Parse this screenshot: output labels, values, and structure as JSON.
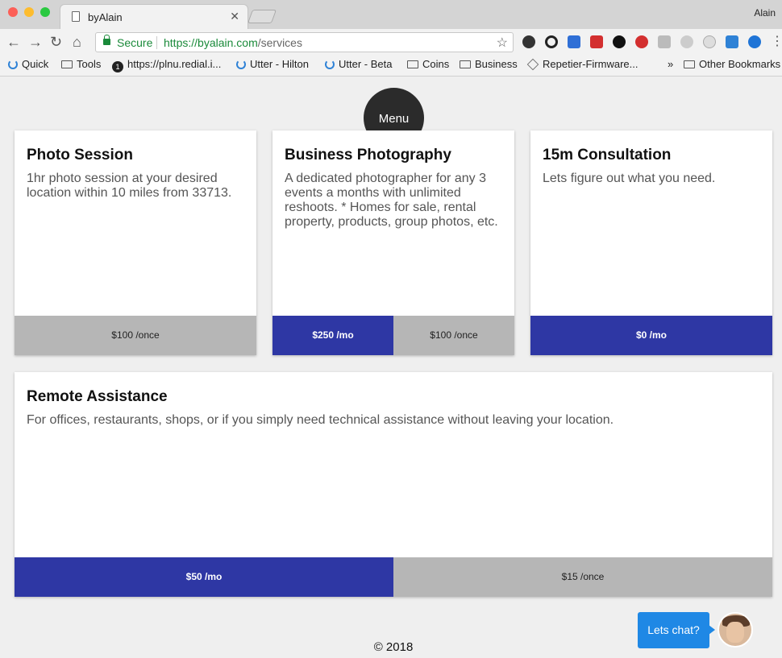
{
  "browser": {
    "tab_title": "byAlain",
    "profile": "Alain",
    "secure_label": "Secure",
    "url_scheme": "https://",
    "url_host": "byalain.com",
    "url_path": "/services",
    "bookmarks": [
      "Quick",
      "Tools",
      "https://plnu.redial.i...",
      "Utter - Hilton",
      "Utter - Beta",
      "Coins",
      "Business",
      "Repetier-Firmware...",
      "»",
      "Other Bookmarks"
    ]
  },
  "menu": {
    "label": "Menu"
  },
  "services": [
    {
      "title": "Photo Session",
      "description": "1hr photo session at your desired location within 10 miles from 33713.",
      "prices": [
        "$100 /once"
      ]
    },
    {
      "title": "Business Photography",
      "description": "A dedicated photographer for any 3 events a months with unlimited reshoots. * Homes for sale, rental property, products, group photos, etc.",
      "prices": [
        "$250 /mo",
        "$100 /once"
      ]
    },
    {
      "title": "15m Consultation",
      "description": "Lets figure out what you need.",
      "prices": [
        "$0 /mo"
      ]
    },
    {
      "title": "Remote Assistance",
      "description": "For offices, restaurants, shops, or if you simply need technical assistance without leaving your location.",
      "prices": [
        "$50 /mo",
        "$15 /once"
      ]
    }
  ],
  "footer": {
    "copyright": "© 2018"
  },
  "chat": {
    "label": "Lets chat?"
  },
  "colors": {
    "accent": "#2e37a4",
    "neutral": "#b6b6b6",
    "chat": "#1f88e5"
  }
}
